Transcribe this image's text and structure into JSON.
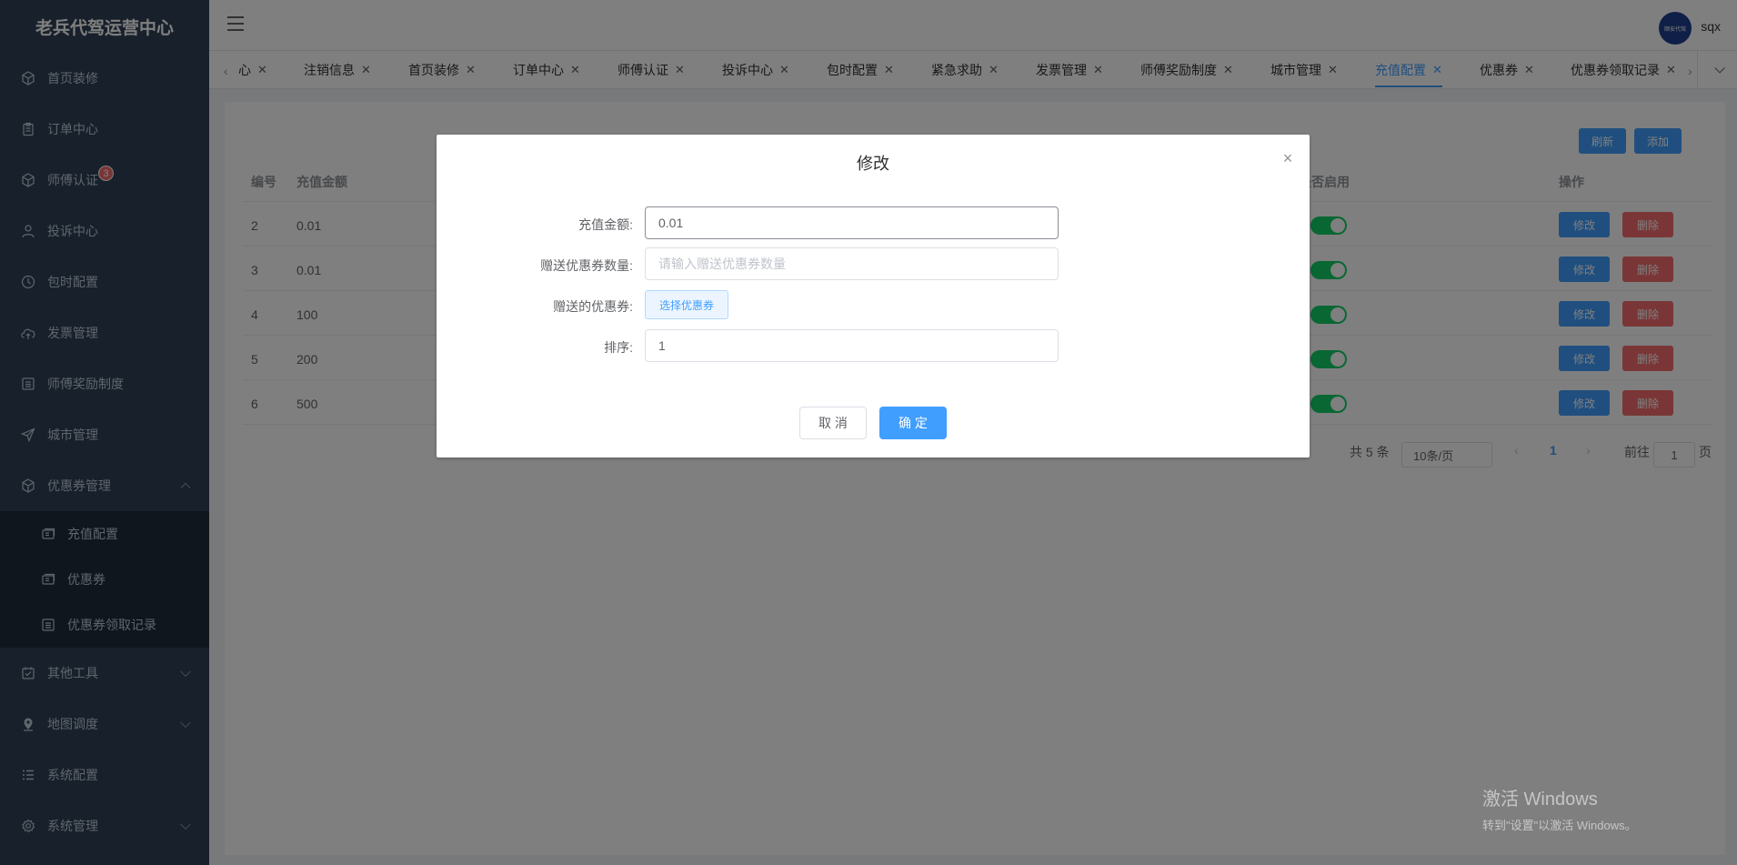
{
  "app": {
    "brand": "老兵代驾运营中心"
  },
  "header": {
    "avatar_text": "顺安代驾",
    "username": "sqx"
  },
  "sidebar": {
    "items": [
      {
        "label": "首页装修",
        "icon": "cube-icon"
      },
      {
        "label": "订单中心",
        "icon": "clipboard-icon"
      },
      {
        "label": "师傅认证",
        "icon": "cube-icon",
        "badge": "3"
      },
      {
        "label": "投诉中心",
        "icon": "user-icon"
      },
      {
        "label": "包时配置",
        "icon": "clock-icon"
      },
      {
        "label": "发票管理",
        "icon": "cloud-upload-icon"
      },
      {
        "label": "师傅奖励制度",
        "icon": "list-icon"
      },
      {
        "label": "城市管理",
        "icon": "send-icon"
      },
      {
        "label": "优惠券管理",
        "icon": "cube-icon"
      }
    ],
    "submenu": [
      {
        "label": "充值配置"
      },
      {
        "label": "优惠券"
      },
      {
        "label": "优惠券领取记录"
      }
    ],
    "bottom": [
      {
        "label": "其他工具"
      },
      {
        "label": "地图调度"
      },
      {
        "label": "系统配置"
      },
      {
        "label": "系统管理"
      }
    ]
  },
  "tabs": [
    {
      "label": "心"
    },
    {
      "label": "注销信息"
    },
    {
      "label": "首页装修"
    },
    {
      "label": "订单中心"
    },
    {
      "label": "师傅认证"
    },
    {
      "label": "投诉中心"
    },
    {
      "label": "包时配置"
    },
    {
      "label": "紧急求助"
    },
    {
      "label": "发票管理"
    },
    {
      "label": "师傅奖励制度"
    },
    {
      "label": "城市管理"
    },
    {
      "label": "充值配置",
      "active": true
    },
    {
      "label": "优惠券"
    },
    {
      "label": "优惠券领取记录"
    }
  ],
  "toolbar": {
    "refresh_label": "刷新",
    "add_label": "添加"
  },
  "table": {
    "headers": {
      "id": "编号",
      "amount": "充值金额",
      "enabled": "是否启用",
      "actions": "操作"
    },
    "rows": [
      {
        "id": "2",
        "amount": "0.01",
        "enabled": true
      },
      {
        "id": "3",
        "amount": "0.01",
        "enabled": true
      },
      {
        "id": "4",
        "amount": "100",
        "enabled": true
      },
      {
        "id": "5",
        "amount": "200",
        "enabled": true
      },
      {
        "id": "6",
        "amount": "500",
        "enabled": true
      }
    ],
    "edit_label": "修改",
    "delete_label": "删除"
  },
  "pagination": {
    "total": "共 5 条",
    "page_size": "10条/页",
    "current_page": "1",
    "goto_label": "前往",
    "goto_value": "1",
    "page_suffix": "页"
  },
  "dialog": {
    "title": "修改",
    "fields": {
      "amount_label": "充值金额:",
      "amount_value": "0.01",
      "coupon_count_label": "赠送优惠券数量:",
      "coupon_count_placeholder": "请输入赠送优惠券数量",
      "coupon_label": "赠送的优惠券:",
      "coupon_button": "选择优惠券",
      "sort_label": "排序:",
      "sort_value": "1"
    },
    "cancel_label": "取 消",
    "ok_label": "确 定"
  },
  "watermark": {
    "line1": "激活 Windows",
    "line2": "转到\"设置\"以激活 Windows。"
  },
  "colors": {
    "primary": "#409eff",
    "danger": "#f56c6c",
    "success": "#13ce66",
    "sidebar_bg": "#304156"
  }
}
